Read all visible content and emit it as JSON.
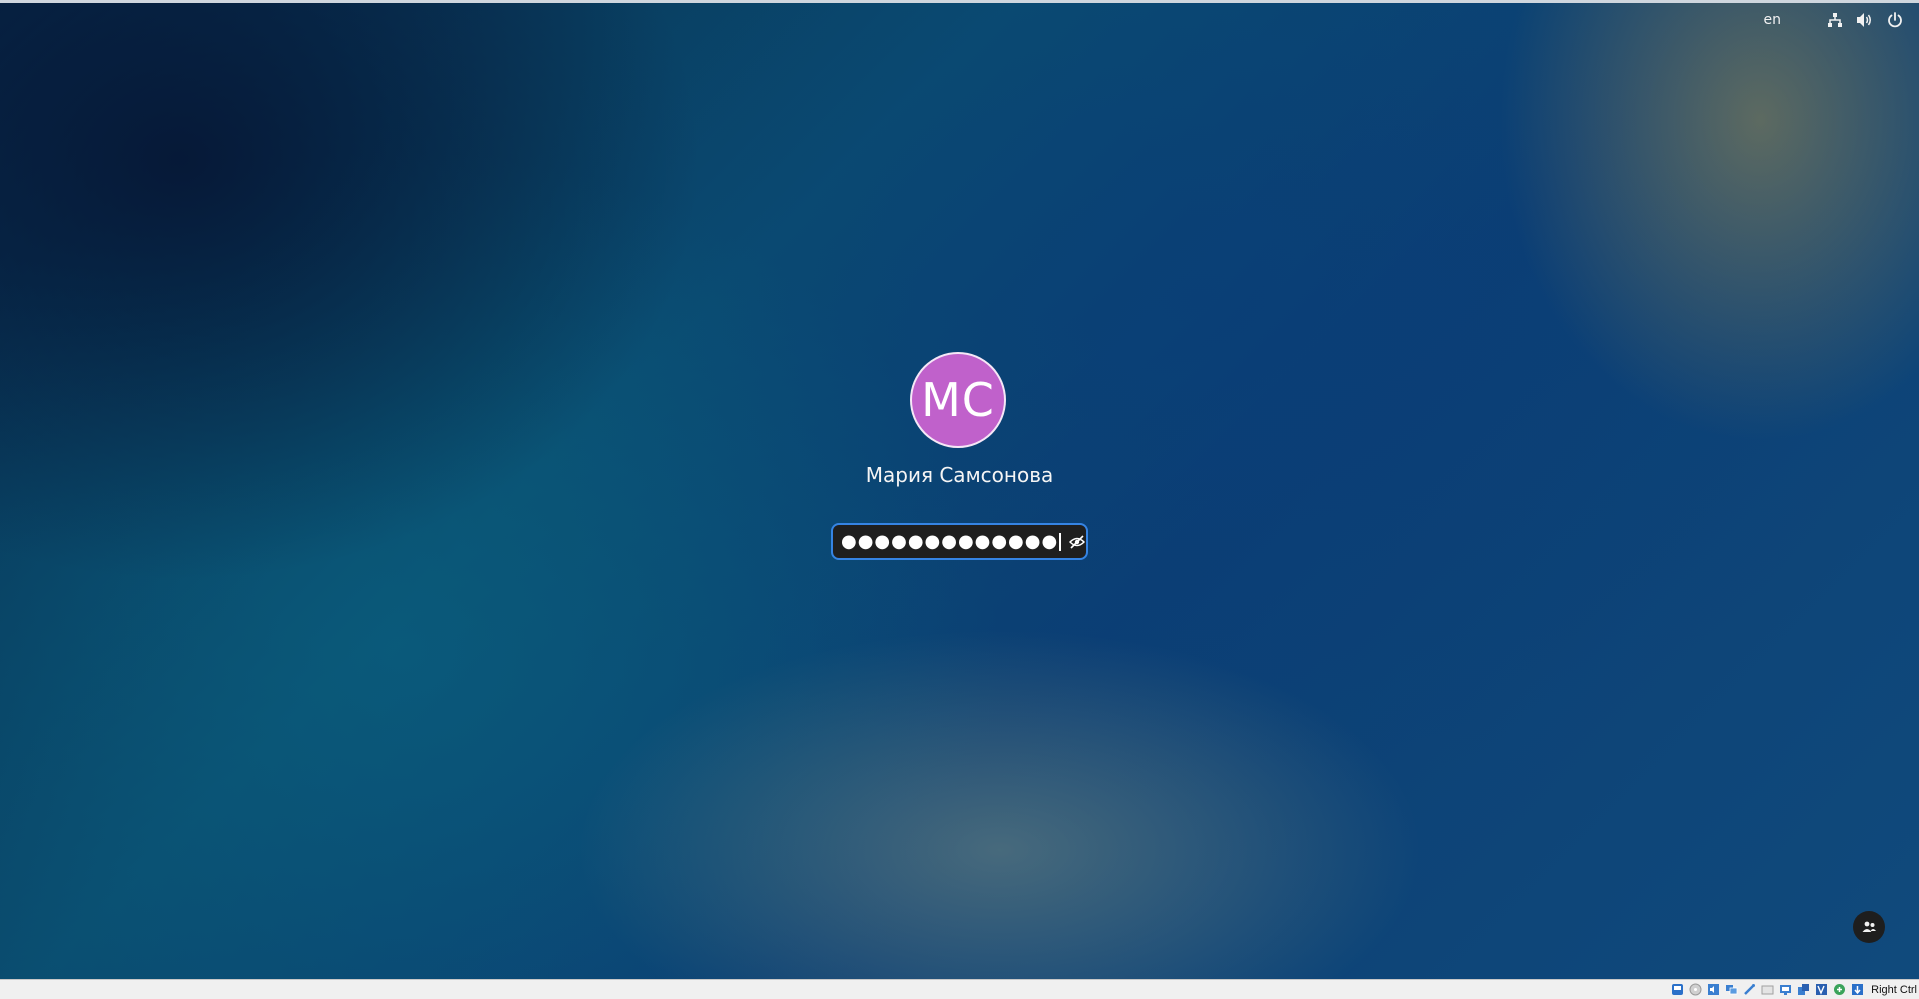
{
  "top_bar": {
    "language": "en",
    "icons": [
      "network-icon",
      "volume-icon",
      "power-icon"
    ]
  },
  "login": {
    "avatar_initials": "MC",
    "avatar_color": "#c061cb",
    "user_name": "Мария Самсонова",
    "password_masked": "●●●●●●●●●●●●●",
    "accent_color": "#3584e4",
    "reveal_icon": "eye-hidden-icon",
    "bottom_right_icon": "user-switch-icon"
  },
  "vm_status_bar": {
    "host_key": "Right Ctrl",
    "icons": [
      "hard-disk-icon",
      "optical-drive-icon",
      "audio-icon",
      "network-icon",
      "usb-icon",
      "shared-folders-icon",
      "display-icon",
      "video-capture-icon",
      "cpu-icon",
      "mouse-integration-icon",
      "keyboard-icon"
    ]
  }
}
